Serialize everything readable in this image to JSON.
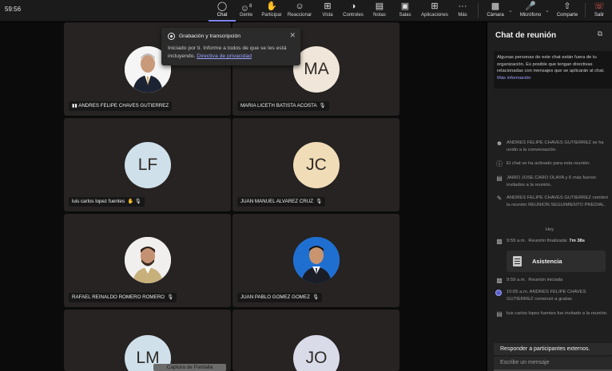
{
  "header": {
    "timer": "59:56",
    "tools": [
      {
        "key": "chat",
        "label": "Chat",
        "icon": "chat-icon"
      },
      {
        "key": "gente",
        "label": "Gente",
        "icon": "people-icon",
        "badge": "8"
      },
      {
        "key": "participar",
        "label": "Participar",
        "icon": "raise-hand-icon"
      },
      {
        "key": "reaccionar",
        "label": "Reaccionar",
        "icon": "emoji-icon"
      },
      {
        "key": "vista",
        "label": "Vista",
        "icon": "grid-view-icon"
      },
      {
        "key": "controles",
        "label": "Controles",
        "icon": "controls-icon"
      },
      {
        "key": "notas",
        "label": "Notas",
        "icon": "notes-icon"
      },
      {
        "key": "salas",
        "label": "Salas",
        "icon": "breakout-rooms-icon"
      },
      {
        "key": "aplicaciones",
        "label": "Aplicaciones",
        "icon": "apps-icon"
      },
      {
        "key": "mas",
        "label": "Más",
        "icon": "more-icon"
      }
    ],
    "camera_label": "Cámara",
    "mic_label": "Micrófono",
    "share_label": "Comparte",
    "leave_label": "Salir"
  },
  "popup": {
    "title": "Grabación y transcripción",
    "body": "Iniciado por ti. Informe a todos de que se les está incluyendo.",
    "link": "Directiva de privacidad"
  },
  "participants": [
    {
      "name": "ANDRES FELIPE CHAVES GUTIERREZ",
      "initials": "",
      "photo": true,
      "color": "#ffffff"
    },
    {
      "name": "MARIA LICETH BATISTA ACOSTA",
      "initials": "MA",
      "photo": false,
      "color": "#f0e6d9"
    },
    {
      "name": "luis carlos lopez fuentes",
      "initials": "LF",
      "photo": false,
      "color": "#cfe0ea"
    },
    {
      "name": "JUAN MANUEL ALVAREZ CRUZ",
      "initials": "JC",
      "photo": false,
      "color": "#f1dcb8"
    },
    {
      "name": "RAFAEL REINALDO ROMERO ROMERO",
      "initials": "",
      "photo": true,
      "color": "#f4f4f4"
    },
    {
      "name": "JUAN PABLO GOMEZ GOMEZ",
      "initials": "",
      "photo": true,
      "color": "#1f6fd1"
    },
    {
      "name": "",
      "initials": "LM",
      "photo": false,
      "color": "#cfe0ea"
    },
    {
      "name": "",
      "initials": "JO",
      "photo": false,
      "color": "#d9dbe9"
    }
  ],
  "chat": {
    "title": "Chat de reunión",
    "notice": "Algunas personas de este chat están fuera de tu organización. Es posible que tengan directivas relacionadas con mensajes que se aplicarán al chat.",
    "notice_link": "Más información",
    "events": [
      {
        "icon": "person-joined-icon",
        "text": "ANDRES FELIPE CHAVES GUTIERREZ se ha unido a la conversación."
      },
      {
        "icon": "info-icon",
        "text": "El chat se ha activado para esta reunión."
      },
      {
        "icon": "calendar-icon",
        "text": "JAIRO JOSE CARO OLAYA y 6 más fueron invitados a la reunión."
      },
      {
        "icon": "pencil-icon",
        "text": "ANDRES FELIPE CHAVES GUTIERREZ nombró la reunión REUNION SEGUIMIENTO PREDIAL."
      }
    ],
    "day_label": "Hoy",
    "ended_time": "9:59 a.m.",
    "ended_text": "Reunión finalizada:",
    "ended_duration": "7m 38s",
    "attendance_label": "Asistencia",
    "started_time": "9:59 a.m.",
    "started_text": "Reunión iniciada",
    "rec_text": "10:05 a.m.   ANDRES FELIPE CHAVES GUTIERREZ comenzó a grabar.",
    "invite_text": "luis carlos lopez fuentes fue invitado a la reunión.",
    "reply_label": "Responder a participantes externos.",
    "compose_placeholder": "Escribe un mensaje"
  },
  "capture_label": "Captura de Pantalla"
}
